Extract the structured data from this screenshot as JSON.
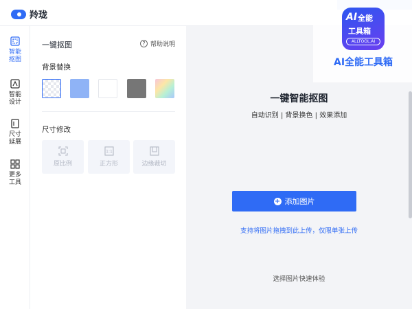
{
  "app": {
    "logo_text": "羚珑"
  },
  "sidebar": {
    "items": [
      {
        "label": "智能\n抠图",
        "icon": "cutout-icon",
        "active": true
      },
      {
        "label": "智能\n设计",
        "icon": "design-icon",
        "active": false
      },
      {
        "label": "尺寸\n延展",
        "icon": "resize-icon",
        "active": false
      },
      {
        "label": "更多\n工具",
        "icon": "grid-icon",
        "active": false
      }
    ]
  },
  "panel": {
    "title": "一键抠图",
    "help_label": "帮助说明",
    "background_section_label": "背景替换",
    "background_swatches": [
      {
        "name": "transparent",
        "color": "transparent"
      },
      {
        "name": "blue",
        "color": "#8fb3f6"
      },
      {
        "name": "white",
        "color": "#ffffff"
      },
      {
        "name": "gray",
        "color": "#767676"
      },
      {
        "name": "gradient",
        "color": "gradient"
      }
    ],
    "size_section_label": "尺寸修改",
    "size_options": [
      {
        "label": "原比例",
        "icon": "original-ratio-icon"
      },
      {
        "label": "正方形",
        "icon": "square-ratio-icon"
      },
      {
        "label": "边缘裁切",
        "icon": "edge-crop-icon"
      }
    ]
  },
  "main": {
    "title": "一键智能抠图",
    "subtitle": "自动识别 | 背景换色 | 效果添加",
    "add_button_label": "添加图片",
    "upload_hint": "支持将图片拖拽到此上传，仅限单张上传",
    "sample_hint": "选择图片快速体验"
  },
  "overlay": {
    "badge_line1": "AI",
    "badge_line2": "全能",
    "badge_line3": "工具箱",
    "badge_url": "ALLTOOL.AI",
    "caption": "AI全能工具箱"
  },
  "colors": {
    "accent": "#2f6bf5",
    "canvas_bg": "#f3f4f7"
  }
}
